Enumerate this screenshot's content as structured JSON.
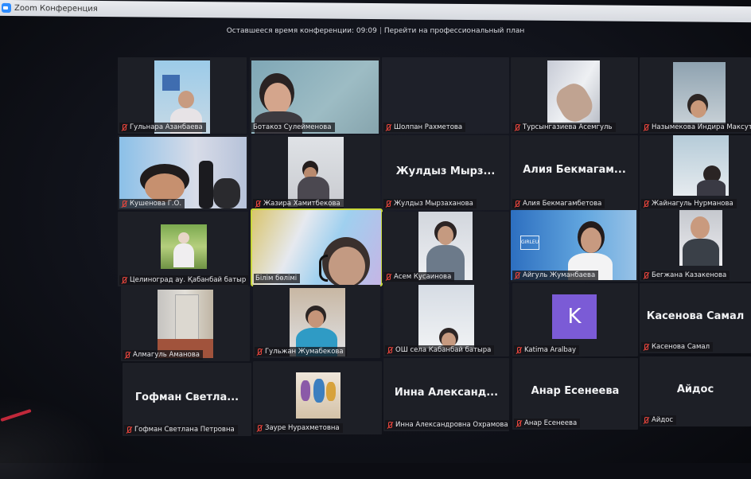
{
  "window": {
    "title": "Zoom Конференция",
    "app_icon": "zoom-camera-icon"
  },
  "banner": {
    "time_text": "Оставшееся время конференции: 09:09",
    "separator": "|",
    "upgrade_link": "Перейти на профессиональный план"
  },
  "colors": {
    "muted_icon": "#e8453c",
    "active_speaker_border": "#c9d93b",
    "avatar_k": "#7b5bd6"
  },
  "participants": [
    {
      "name": "Гульнара Азанбаева",
      "muted": true,
      "video": true
    },
    {
      "name": "Ботакоз Сулейменова",
      "muted": false,
      "video": true
    },
    {
      "name": "Шолпан Рахметова",
      "muted": true,
      "video": false
    },
    {
      "name": "Турсынгазиева Асемгуль",
      "muted": true,
      "video": true
    },
    {
      "name": "Назымекова Индира Максутовна",
      "muted": true,
      "video": true
    },
    {
      "name": "Кушенова Г.О.",
      "muted": true,
      "video": true
    },
    {
      "name": "Жазира Хамитбекова",
      "muted": true,
      "video": true
    },
    {
      "name": "Жулдыз Мырзаханова",
      "display": "Жулдыз Мырз...",
      "muted": true,
      "video": false
    },
    {
      "name": "Алия Бекмагамбетова",
      "display": "Алия Бекмагам...",
      "muted": true,
      "video": false
    },
    {
      "name": "Жайнагуль Нурманова",
      "muted": true,
      "video": true
    },
    {
      "name": "Целиноград ау. Қабанбай батыр ...",
      "muted": true,
      "video": true
    },
    {
      "name": "Білім бөлімі",
      "muted": false,
      "video": true,
      "active": true
    },
    {
      "name": "Асем Кусаинова",
      "muted": true,
      "video": true
    },
    {
      "name": "Айгуль Жуманбаева",
      "muted": true,
      "video": true,
      "logo": "GIRLEU"
    },
    {
      "name": "Бегжана Казакенова",
      "muted": true,
      "video": true
    },
    {
      "name": "Алмагуль Аманова",
      "muted": true,
      "video": true
    },
    {
      "name": "Гульжан Жумабекова",
      "muted": true,
      "video": true
    },
    {
      "name": "ОШ села Кабанбай батыра",
      "muted": true,
      "video": true
    },
    {
      "name": "Katima Aralbay",
      "muted": true,
      "video": false,
      "avatar": "K"
    },
    {
      "name": "Касенова Самал",
      "display": "Касенова Самал",
      "muted": true,
      "video": false
    },
    {
      "name": "Гофман Светлана Петровна",
      "display": "Гофман Светла...",
      "muted": true,
      "video": false
    },
    {
      "name": "Зауре Нурахметовна",
      "muted": true,
      "video": true
    },
    {
      "name": "Инна Александровна Охрамова",
      "display": "Инна Александ...",
      "muted": true,
      "video": false
    },
    {
      "name": "Анар Есенеева",
      "display": "Анар Есенеева",
      "muted": true,
      "video": false
    },
    {
      "name": "Айдос",
      "display": "Айдос",
      "muted": true,
      "video": false
    }
  ]
}
